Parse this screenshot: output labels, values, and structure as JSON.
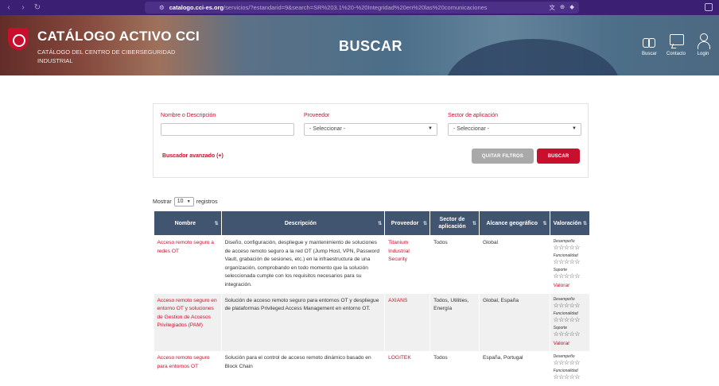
{
  "browser": {
    "url_host": "catalogo.cci-es.org",
    "url_path": "/servicios/?estandarid=9&search=SR%203.1%20-%20Integridad%20en%20las%20comunicaciones",
    "back_icon": "chevron-left-icon",
    "forward_icon": "chevron-right-icon",
    "reload_icon": "reload-icon"
  },
  "header": {
    "title": "CATÁLOGO ACTIVO CCI",
    "subtitle": "CATÁLOGO DEL CENTRO DE CIBERSEGURIDAD INDUSTRIAL",
    "page_heading": "BUSCAR",
    "nav": [
      {
        "label": "Buscar",
        "icon": "binoculars-icon"
      },
      {
        "label": "Contacto",
        "icon": "chat-icon"
      },
      {
        "label": "Login",
        "icon": "user-icon"
      }
    ]
  },
  "filters": {
    "name_label": "Nombre o Descripción",
    "name_value": "",
    "provider_label": "Proveedor",
    "provider_value": "- Seleccionar -",
    "sector_label": "Sector de aplicación",
    "sector_value": "- Seleccionar -",
    "advanced_link": "Buscador avanzado (+)",
    "clear_button": "QUITAR FILTROS",
    "search_button": "BUSCAR"
  },
  "entries": {
    "prefix": "Mostrar",
    "value": "10",
    "suffix": "registros"
  },
  "table": {
    "headers": [
      "Nombre",
      "Descripción",
      "Proveedor",
      "Sector de aplicación",
      "Alcance geográfico",
      "Valoración"
    ],
    "rating_labels": [
      "Desempeño",
      "Funcionalidad",
      "Soporte"
    ],
    "stars": "☆☆☆☆☆",
    "rate_link": "Valorar",
    "rows": [
      {
        "name": "Acceso remoto seguro a redes OT",
        "description": "Diseño, configuración, despliegue y mantenimiento de soluciones de acceso remoto seguro a la red OT (Jump Host, VPN, Password Vault, grabación de sesiones, etc.) en la infraestructura de una organización, comprobando en todo momento que la solución seleccionada cumple con los requisitos necesarios para su integración.",
        "provider": "Titanium Industrial Security",
        "sector": "Todos",
        "scope": "Global"
      },
      {
        "name": "Acceso remoto seguro en entorno OT y soluciones de Gestion de Accesos Privilegiados (PAM)",
        "description": "Solución de acceso remoto seguro para entornos OT y despliegue de plataformas Privileged Access Management en entorno OT.",
        "provider": "AXIANS",
        "sector": "Todos, Utilities, Energía",
        "scope": "Global, España"
      },
      {
        "name": "Acceso remoto seguro para entornos OT",
        "description": "Solución para el control de acceso remoto dinámico basado en Block Chain",
        "provider": "LOGITEK",
        "sector": "Todos",
        "scope": "España, Portugal"
      }
    ]
  }
}
